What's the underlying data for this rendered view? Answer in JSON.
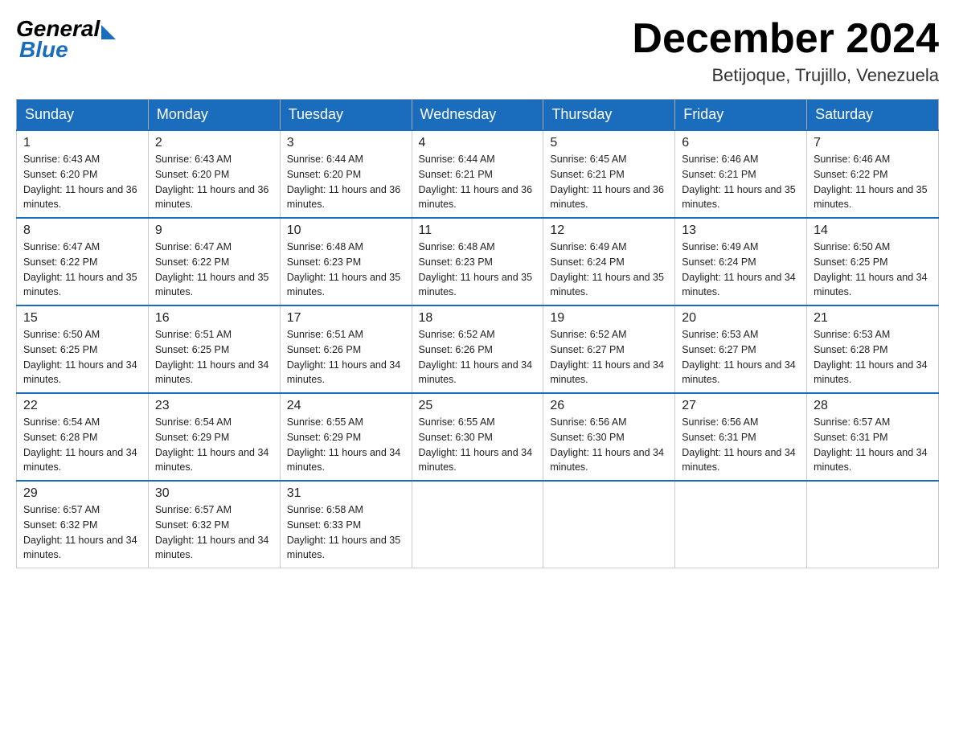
{
  "header": {
    "logo_general": "General",
    "logo_blue": "Blue",
    "month_title": "December 2024",
    "location": "Betijoque, Trujillo, Venezuela"
  },
  "days_of_week": [
    "Sunday",
    "Monday",
    "Tuesday",
    "Wednesday",
    "Thursday",
    "Friday",
    "Saturday"
  ],
  "weeks": [
    [
      {
        "day": "1",
        "sunrise": "6:43 AM",
        "sunset": "6:20 PM",
        "daylight": "11 hours and 36 minutes."
      },
      {
        "day": "2",
        "sunrise": "6:43 AM",
        "sunset": "6:20 PM",
        "daylight": "11 hours and 36 minutes."
      },
      {
        "day": "3",
        "sunrise": "6:44 AM",
        "sunset": "6:20 PM",
        "daylight": "11 hours and 36 minutes."
      },
      {
        "day": "4",
        "sunrise": "6:44 AM",
        "sunset": "6:21 PM",
        "daylight": "11 hours and 36 minutes."
      },
      {
        "day": "5",
        "sunrise": "6:45 AM",
        "sunset": "6:21 PM",
        "daylight": "11 hours and 36 minutes."
      },
      {
        "day": "6",
        "sunrise": "6:46 AM",
        "sunset": "6:21 PM",
        "daylight": "11 hours and 35 minutes."
      },
      {
        "day": "7",
        "sunrise": "6:46 AM",
        "sunset": "6:22 PM",
        "daylight": "11 hours and 35 minutes."
      }
    ],
    [
      {
        "day": "8",
        "sunrise": "6:47 AM",
        "sunset": "6:22 PM",
        "daylight": "11 hours and 35 minutes."
      },
      {
        "day": "9",
        "sunrise": "6:47 AM",
        "sunset": "6:22 PM",
        "daylight": "11 hours and 35 minutes."
      },
      {
        "day": "10",
        "sunrise": "6:48 AM",
        "sunset": "6:23 PM",
        "daylight": "11 hours and 35 minutes."
      },
      {
        "day": "11",
        "sunrise": "6:48 AM",
        "sunset": "6:23 PM",
        "daylight": "11 hours and 35 minutes."
      },
      {
        "day": "12",
        "sunrise": "6:49 AM",
        "sunset": "6:24 PM",
        "daylight": "11 hours and 35 minutes."
      },
      {
        "day": "13",
        "sunrise": "6:49 AM",
        "sunset": "6:24 PM",
        "daylight": "11 hours and 34 minutes."
      },
      {
        "day": "14",
        "sunrise": "6:50 AM",
        "sunset": "6:25 PM",
        "daylight": "11 hours and 34 minutes."
      }
    ],
    [
      {
        "day": "15",
        "sunrise": "6:50 AM",
        "sunset": "6:25 PM",
        "daylight": "11 hours and 34 minutes."
      },
      {
        "day": "16",
        "sunrise": "6:51 AM",
        "sunset": "6:25 PM",
        "daylight": "11 hours and 34 minutes."
      },
      {
        "day": "17",
        "sunrise": "6:51 AM",
        "sunset": "6:26 PM",
        "daylight": "11 hours and 34 minutes."
      },
      {
        "day": "18",
        "sunrise": "6:52 AM",
        "sunset": "6:26 PM",
        "daylight": "11 hours and 34 minutes."
      },
      {
        "day": "19",
        "sunrise": "6:52 AM",
        "sunset": "6:27 PM",
        "daylight": "11 hours and 34 minutes."
      },
      {
        "day": "20",
        "sunrise": "6:53 AM",
        "sunset": "6:27 PM",
        "daylight": "11 hours and 34 minutes."
      },
      {
        "day": "21",
        "sunrise": "6:53 AM",
        "sunset": "6:28 PM",
        "daylight": "11 hours and 34 minutes."
      }
    ],
    [
      {
        "day": "22",
        "sunrise": "6:54 AM",
        "sunset": "6:28 PM",
        "daylight": "11 hours and 34 minutes."
      },
      {
        "day": "23",
        "sunrise": "6:54 AM",
        "sunset": "6:29 PM",
        "daylight": "11 hours and 34 minutes."
      },
      {
        "day": "24",
        "sunrise": "6:55 AM",
        "sunset": "6:29 PM",
        "daylight": "11 hours and 34 minutes."
      },
      {
        "day": "25",
        "sunrise": "6:55 AM",
        "sunset": "6:30 PM",
        "daylight": "11 hours and 34 minutes."
      },
      {
        "day": "26",
        "sunrise": "6:56 AM",
        "sunset": "6:30 PM",
        "daylight": "11 hours and 34 minutes."
      },
      {
        "day": "27",
        "sunrise": "6:56 AM",
        "sunset": "6:31 PM",
        "daylight": "11 hours and 34 minutes."
      },
      {
        "day": "28",
        "sunrise": "6:57 AM",
        "sunset": "6:31 PM",
        "daylight": "11 hours and 34 minutes."
      }
    ],
    [
      {
        "day": "29",
        "sunrise": "6:57 AM",
        "sunset": "6:32 PM",
        "daylight": "11 hours and 34 minutes."
      },
      {
        "day": "30",
        "sunrise": "6:57 AM",
        "sunset": "6:32 PM",
        "daylight": "11 hours and 34 minutes."
      },
      {
        "day": "31",
        "sunrise": "6:58 AM",
        "sunset": "6:33 PM",
        "daylight": "11 hours and 35 minutes."
      },
      null,
      null,
      null,
      null
    ]
  ]
}
